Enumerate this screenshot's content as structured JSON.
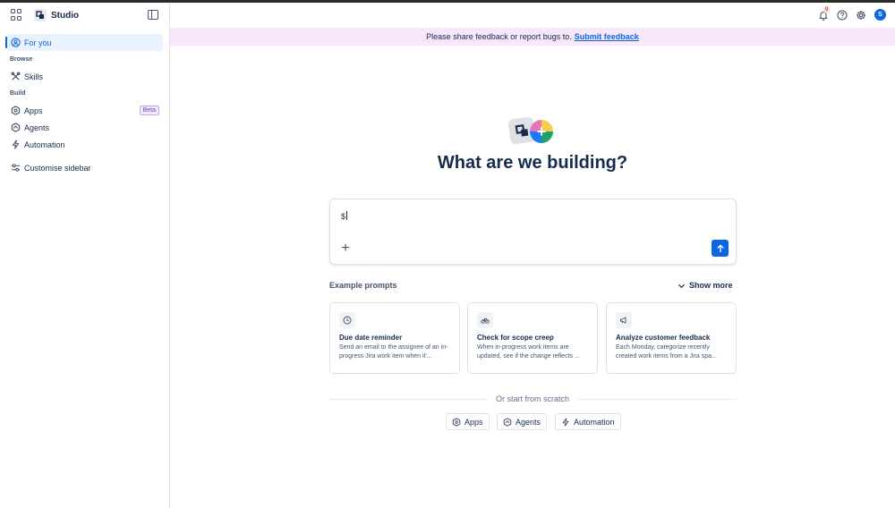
{
  "sidebar": {
    "title": "Studio",
    "items": [
      {
        "label": "For you",
        "icon": "person-circle-icon",
        "active": true
      },
      {
        "label": "Skills",
        "icon": "tools-icon"
      },
      {
        "label": "Apps",
        "icon": "apps-hexagon-icon",
        "badge": "Beta"
      },
      {
        "label": "Agents",
        "icon": "agent-icon"
      },
      {
        "label": "Automation",
        "icon": "lightning-icon"
      },
      {
        "label": "Customise sidebar",
        "icon": "sliders-icon"
      }
    ],
    "sections": {
      "browse": "Browse",
      "build": "Build"
    }
  },
  "topbar": {
    "notification_count": "9",
    "avatar_initial": "S"
  },
  "banner": {
    "text": "Please share feedback or report bugs to.",
    "link": "Submit feedback"
  },
  "hero": {
    "title": "What are we building?"
  },
  "prompt": {
    "value": "$"
  },
  "examples": {
    "label": "Example prompts",
    "show_more": "Show more",
    "cards": [
      {
        "title": "Due date reminder",
        "desc": "Send an email to the assignee of an in-progress Jira work item when it'...",
        "icon": "clock-icon"
      },
      {
        "title": "Check for scope creep",
        "desc": "When in-progress work items are updated, see if the change reflects ...",
        "icon": "bicycle-icon"
      },
      {
        "title": "Analyze customer feedback",
        "desc": "Each Monday, categorize recently created work items from a Jira spa...",
        "icon": "megaphone-icon"
      }
    ]
  },
  "scratch": {
    "label": "Or start from scratch",
    "buttons": [
      {
        "label": "Apps",
        "icon": "apps-hexagon-icon"
      },
      {
        "label": "Agents",
        "icon": "agent-icon"
      },
      {
        "label": "Automation",
        "icon": "lightning-icon"
      }
    ]
  },
  "colors": {
    "accent": "#0c66e4",
    "banner_bg": "#f8e6fb",
    "beta_bg": "#f3e8fd"
  }
}
